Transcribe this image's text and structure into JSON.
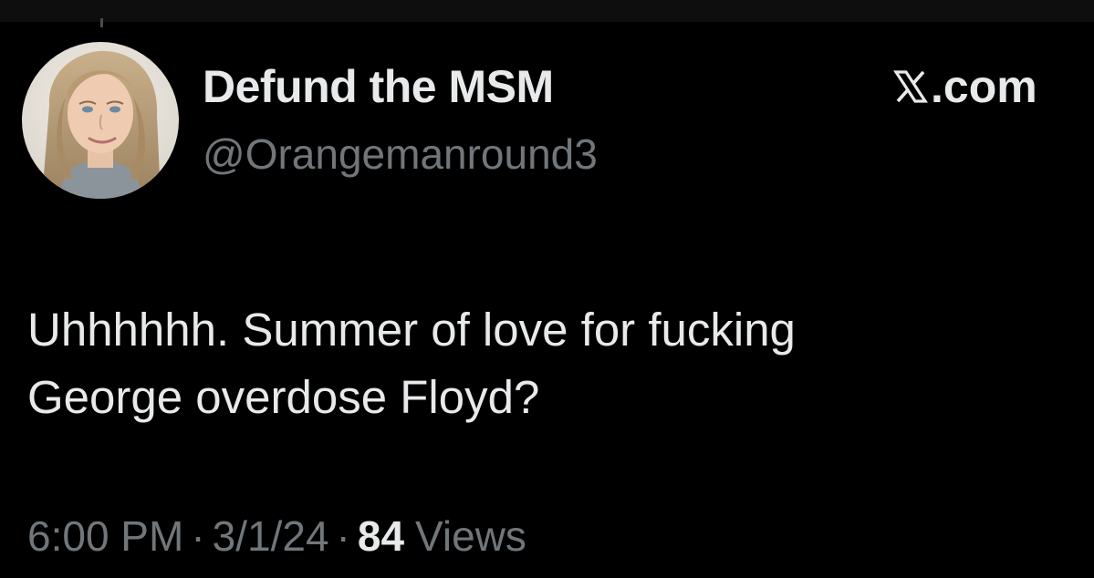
{
  "author": {
    "display_name": "Defund the MSM",
    "handle": "@Orangemanround3",
    "avatar_icon": "profile-photo"
  },
  "brand": {
    "logo_icon": "x-logo-icon",
    "label": ".com"
  },
  "tweet": {
    "text": "Uhhhhhh. Summer of love for fucking\nGeorge overdose Floyd?"
  },
  "meta": {
    "time": "6:00 PM",
    "separator": "·",
    "date": "3/1/24",
    "views_count": "84",
    "views_label": "Views"
  },
  "colors": {
    "background": "#000000",
    "primary_text": "#e7e9ea",
    "secondary_text": "#71767b"
  }
}
